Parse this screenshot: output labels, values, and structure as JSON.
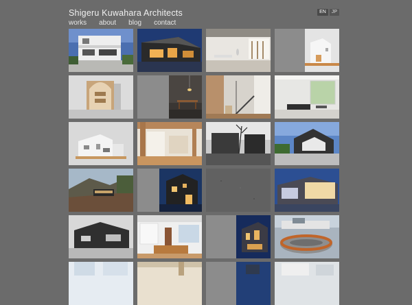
{
  "site": {
    "title": "Shigeru Kuwahara Architects"
  },
  "nav": [
    {
      "label": "works"
    },
    {
      "label": "about"
    },
    {
      "label": "blog"
    },
    {
      "label": "contact"
    }
  ],
  "lang": [
    {
      "label": "EN",
      "active": true
    },
    {
      "label": "JP",
      "active": false
    }
  ],
  "colors": {
    "background": "#6b6b6b",
    "placeholder": "#8c8c8c",
    "text": "#e8e8e8"
  }
}
